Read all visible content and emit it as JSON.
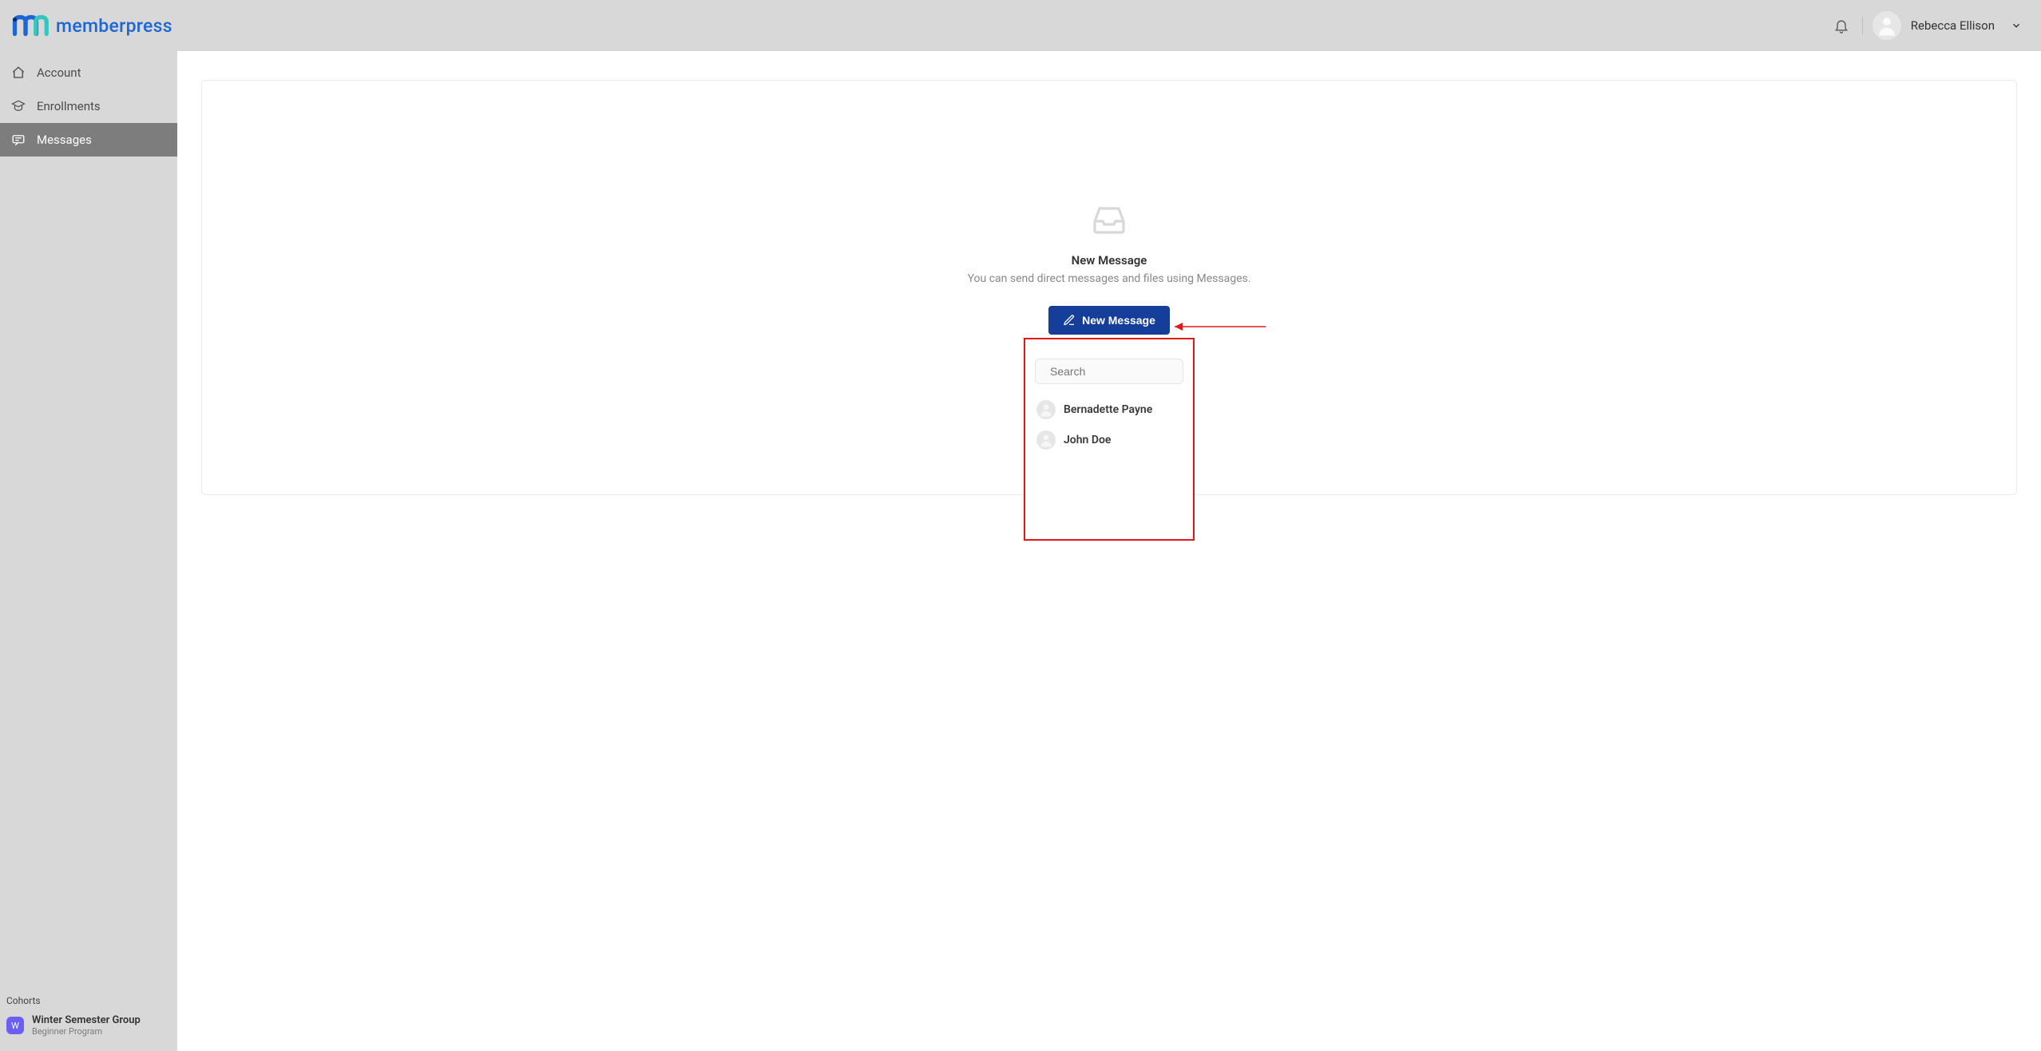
{
  "header": {
    "logo_text": "memberpress",
    "user_name": "Rebecca Ellison"
  },
  "sidebar": {
    "items": [
      {
        "label": "Account",
        "icon": "home-icon",
        "active": false
      },
      {
        "label": "Enrollments",
        "icon": "enrollments-icon",
        "active": false
      },
      {
        "label": "Messages",
        "icon": "messages-icon",
        "active": true
      }
    ],
    "cohorts_heading": "Cohorts",
    "cohort": {
      "badge_letter": "W",
      "title": "Winter Semester Group",
      "subtitle": "Beginner Program"
    }
  },
  "main": {
    "empty_title": "New Message",
    "empty_subtitle": "You can send direct messages and files using Messages.",
    "new_message_button": "New Message",
    "search_placeholder": "Search",
    "contacts": [
      {
        "name": "Bernadette Payne"
      },
      {
        "name": "John Doe"
      }
    ]
  }
}
